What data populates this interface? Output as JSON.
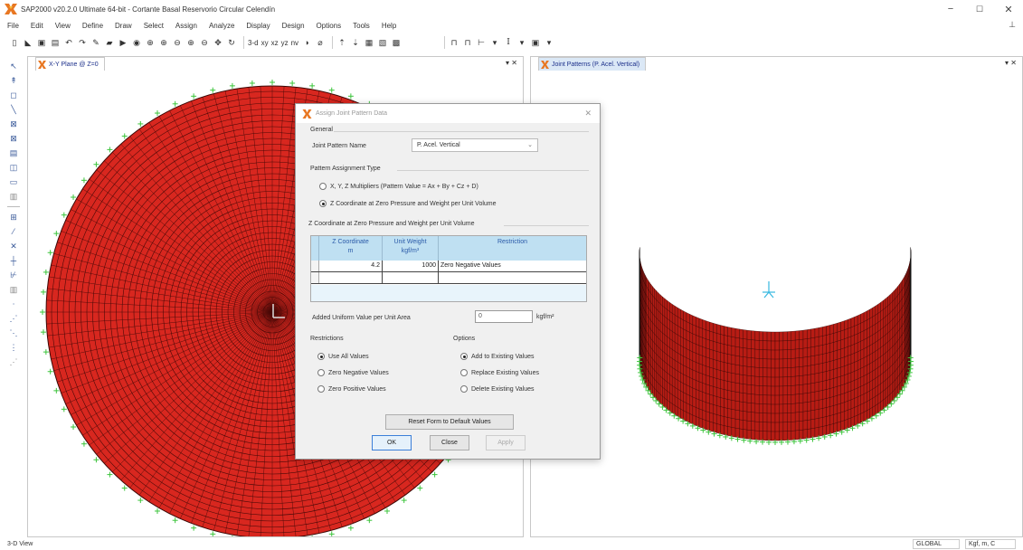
{
  "window": {
    "title": "SAP2000 v20.2.0 Ultimate 64-bit - Cortante Basal Reservorio Circular Celendín",
    "min": "−",
    "max": "☐",
    "close": "✕"
  },
  "menu": {
    "items": [
      "File",
      "Edit",
      "View",
      "Define",
      "Draw",
      "Select",
      "Assign",
      "Analyze",
      "Display",
      "Design",
      "Options",
      "Tools",
      "Help"
    ]
  },
  "toolbar": {
    "labels": [
      "3-d",
      "xy",
      "xz",
      "yz",
      "nv"
    ]
  },
  "panels": {
    "left": {
      "tab_title": "X-Y Plane @ Z=0",
      "controls": "▾ ✕"
    },
    "right": {
      "tab_title": "Joint Patterns (P. Acel. Vertical)",
      "controls": "▾ ✕"
    }
  },
  "dialog": {
    "title": "Assign Joint Pattern Data",
    "close": "✕",
    "general_heading": "General",
    "pattern_name_label": "Joint Pattern Name",
    "pattern_name_value": "P. Acel. Vertical",
    "assignment_type_heading": "Pattern Assignment Type",
    "option_xyz": "X, Y, Z Multipliers  (Pattern Value = Ax + By + Cz + D)",
    "option_zcoord": "Z Coordinate at Zero Pressure and Weight per Unit Volume",
    "zcoord_heading": "Z Coordinate at Zero Pressure and Weight per Unit Volume",
    "grid": {
      "headers": [
        {
          "line1": "Z Coordinate",
          "line2": "m"
        },
        {
          "line1": "Unit Weight",
          "line2": "kgf/m³"
        },
        {
          "line1": "Restriction",
          "line2": ""
        }
      ],
      "rows": [
        [
          "4.2",
          "1000",
          "Zero Negative Values"
        ],
        [
          "",
          "",
          ""
        ]
      ]
    },
    "added_uniform_label": "Added Uniform Value per Unit Area",
    "added_uniform_value": "0",
    "added_uniform_unit": "kgf/m²",
    "restrictions_heading": "Restrictions",
    "restrictions": [
      {
        "label": "Use All Values",
        "selected": true
      },
      {
        "label": "Zero Negative Values",
        "selected": false
      },
      {
        "label": "Zero Positive Values",
        "selected": false
      }
    ],
    "options_heading": "Options",
    "options": [
      {
        "label": "Add to Existing Values",
        "selected": true
      },
      {
        "label": "Replace Existing Values",
        "selected": false
      },
      {
        "label": "Delete Existing Values",
        "selected": false
      }
    ],
    "reset_button": "Reset Form to Default Values",
    "ok_button": "OK",
    "close_button": "Close",
    "apply_button": "Apply"
  },
  "status": {
    "left_text": "3-D View",
    "coord_system": "GLOBAL",
    "units": "Kgf, m, C"
  },
  "colors": {
    "mesh_fill": "#d8271f",
    "mesh_line": "#4a0a08",
    "support": "#3cc43c",
    "accent": "#3c7fd8"
  }
}
